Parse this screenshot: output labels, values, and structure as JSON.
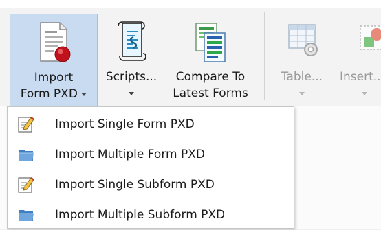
{
  "ribbon": {
    "buttons": [
      {
        "line1": "Import",
        "line2": "Form PXD",
        "icon": "import-form-icon"
      },
      {
        "line1": "Scripts...",
        "icon": "script-scroll-icon"
      },
      {
        "line1": "Compare To",
        "line2": "Latest Forms",
        "icon": "compare-forms-icon"
      },
      {
        "line1": "Table...",
        "icon": "table-settings-icon"
      },
      {
        "line1": "Insert...",
        "icon": "insert-shapes-icon"
      }
    ]
  },
  "menu": {
    "items": [
      {
        "label": "Import Single Form PXD",
        "icon": "form-edit-icon"
      },
      {
        "label": "Import Multiple Form PXD",
        "icon": "folder-icon"
      },
      {
        "label": "Import Single Subform PXD",
        "icon": "form-edit-icon"
      },
      {
        "label": "Import Multiple Subform PXD",
        "icon": "folder-icon"
      }
    ]
  },
  "colors": {
    "active_bg": "#c8dbf0",
    "active_border": "#9fc1e6",
    "disabled_text": "#9a9a9a"
  }
}
